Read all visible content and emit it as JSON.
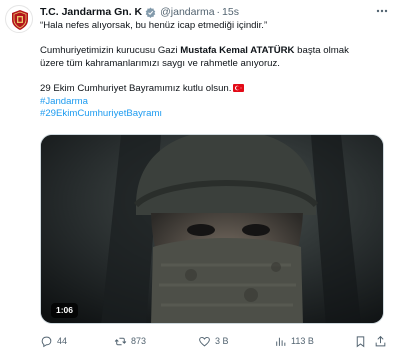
{
  "post": {
    "author_name": "T.C. Jandarma Gn. K",
    "handle": "@jandarma",
    "separator": "·",
    "time": "15s",
    "paragraphs": {
      "quote": "“Hala nefes alıyorsak, bu henüz icap etmediği içindir.”",
      "line2_part1": "Cumhuriyetimizin kurucusu Gazi ",
      "line2_bold": "Mustafa Kemal ATATÜRK",
      "line2_part2": " başta olmak",
      "line3": "üzere tüm kahramanlarımızı saygı ve rahmetle anıyoruz.",
      "line4": "29 Ekim Cumhuriyet Bayramımız kutlu olsun."
    },
    "hashtags": [
      "#Jandarma",
      "#29EkimCumhuriyetBayramı"
    ],
    "media": {
      "duration": "1:06"
    },
    "actions": {
      "replies": "44",
      "reposts": "873",
      "likes": "3 B",
      "views": "113 B"
    }
  },
  "icons": {
    "verified": "verified-badge-icon",
    "flag": "turkey-flag-icon",
    "more": "more-options-icon",
    "reply": "reply-icon",
    "repost": "repost-icon",
    "like": "heart-icon",
    "views": "views-chart-icon",
    "bookmark": "bookmark-icon",
    "share": "share-icon"
  },
  "colors": {
    "text": "#0f1419",
    "secondary": "#536471",
    "link": "#1d9bf0",
    "verified": "#829aab"
  }
}
